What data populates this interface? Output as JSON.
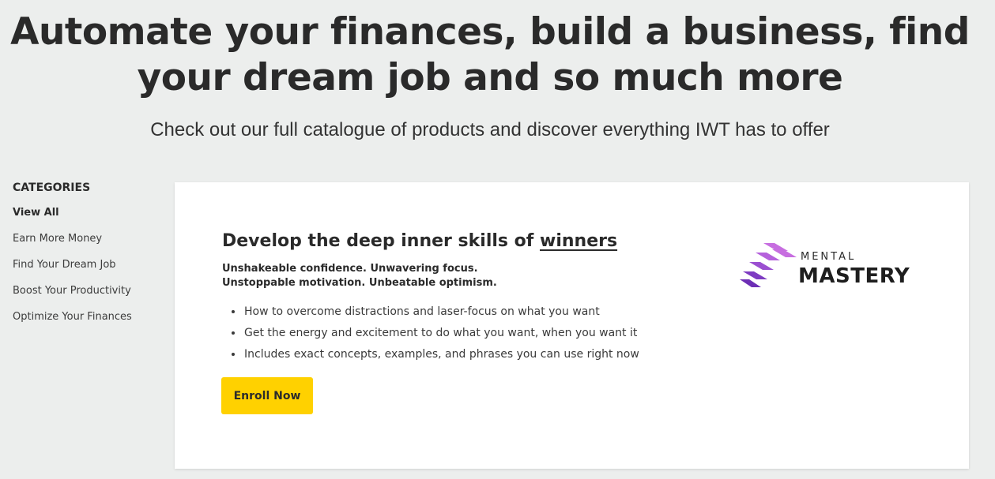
{
  "hero": {
    "title_line1": "Automate your finances, build a business, find",
    "title_line2": "your dream job and so much more",
    "subtitle": "Check out our full catalogue of products and discover everything IWT has to offer"
  },
  "sidebar": {
    "heading": "CATEGORIES",
    "items": [
      {
        "label": "View All",
        "active": true
      },
      {
        "label": "Earn More Money",
        "active": false
      },
      {
        "label": "Find Your Dream Job",
        "active": false
      },
      {
        "label": "Boost Your Productivity",
        "active": false
      },
      {
        "label": "Optimize Your Finances",
        "active": false
      }
    ]
  },
  "product": {
    "title_prefix": "Develop the deep inner skills of ",
    "title_emphasis": "winners",
    "tagline_line1": "Unshakeable confidence. Unwavering focus.",
    "tagline_line2": "Unstoppable motivation. Unbeatable optimism.",
    "bullets": [
      "How to overcome distractions and laser-focus on what you want",
      "Get the energy and excitement to do what you want, when you want it",
      "Includes exact concepts, examples, and phrases you can use right now"
    ],
    "cta_label": "Enroll Now",
    "logo": {
      "small_text": "MENTAL",
      "big_text": "MASTERY",
      "icon": "stairs-logo-icon",
      "colors": [
        "#c76ee0",
        "#9b4fd1",
        "#6d2fb5"
      ]
    }
  },
  "colors": {
    "page_background": "#eceeed",
    "card_background": "#ffffff",
    "button": "#ffd100",
    "text": "#2b2b2b"
  }
}
